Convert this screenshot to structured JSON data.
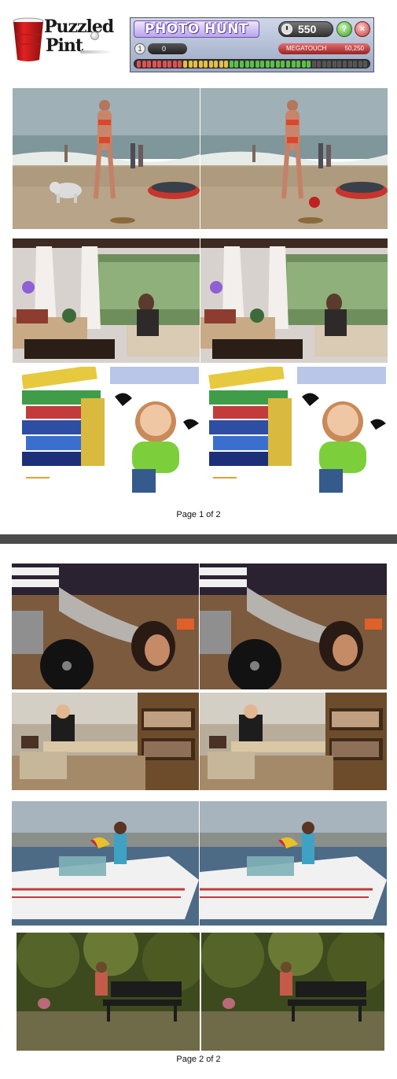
{
  "header": {
    "logo_line1": "Puzzled",
    "logo_line2": "Pint",
    "game_title": "PHOTO HUNT",
    "score": "550",
    "lives_value": "0",
    "megatouch_label": "MEGATOUCH",
    "megatouch_value": "50,250",
    "timer_fraction": 0.75
  },
  "pages": [
    {
      "footer": "Page 1 of 2"
    },
    {
      "footer": "Page 2 of 2"
    }
  ],
  "colors": {
    "page_background": "#ffffff",
    "viewer_background": "#4a4a4a",
    "banner_purple": "#6d54b4",
    "megatouch_red": "#c23a3a"
  },
  "icons": [
    "red-cup-icon",
    "golf-ball-icon",
    "clock-icon",
    "hint-icon",
    "quit-icon"
  ]
}
